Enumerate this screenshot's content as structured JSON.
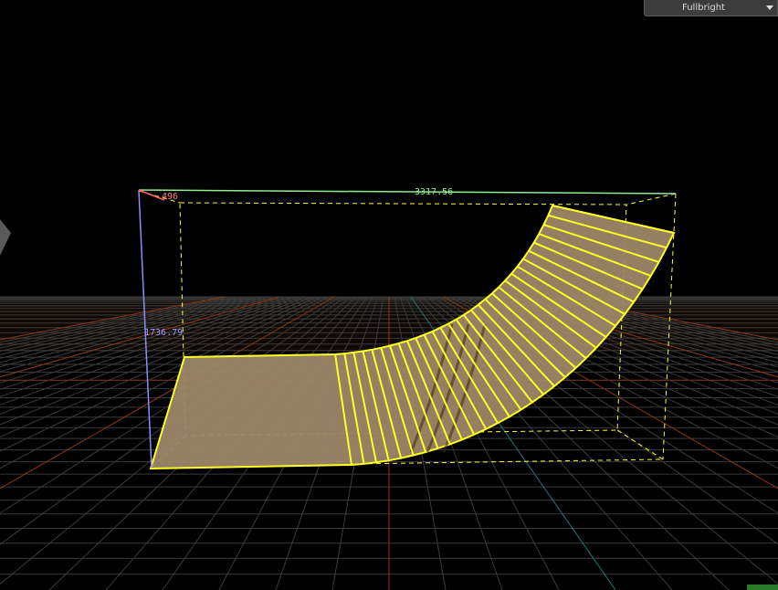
{
  "viewport": {
    "render_mode": "Fullbright"
  },
  "selection": {
    "size_x": "3317.56",
    "size_y": "496",
    "size_z": "1736.79"
  },
  "colors": {
    "grid": "#3b3b3b",
    "grid_x_axis": "#8a3a14",
    "grid_y_axis": "#1d7a7a",
    "selection_outline": "#ffff22",
    "surface_fill": "#9c8668",
    "dim_x": "#90ee90",
    "dim_y": "#ff6060",
    "dim_z": "#8c8cff"
  }
}
